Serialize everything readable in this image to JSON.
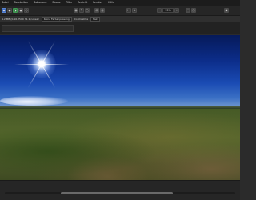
{
  "menu": [
    "Datei",
    "Bearbeiten",
    "Dokument",
    "Ebene",
    "Filter",
    "Ansicht",
    "Fenster",
    "Hilfe"
  ],
  "toolbar": {
    "tool_icons": [
      "grid-icon",
      "brush-icon",
      "selection-icon"
    ],
    "zoom_value": "25",
    "zoom_unit": "%"
  },
  "context": {
    "info": "4.2 MB (0.16.2500 31.1) Linear",
    "layer_name": "Keine Farbanpassung",
    "blend_label": "Contrastiva",
    "blend_value": "Fisk"
  },
  "status": {
    "scroll_position": 0.47
  }
}
